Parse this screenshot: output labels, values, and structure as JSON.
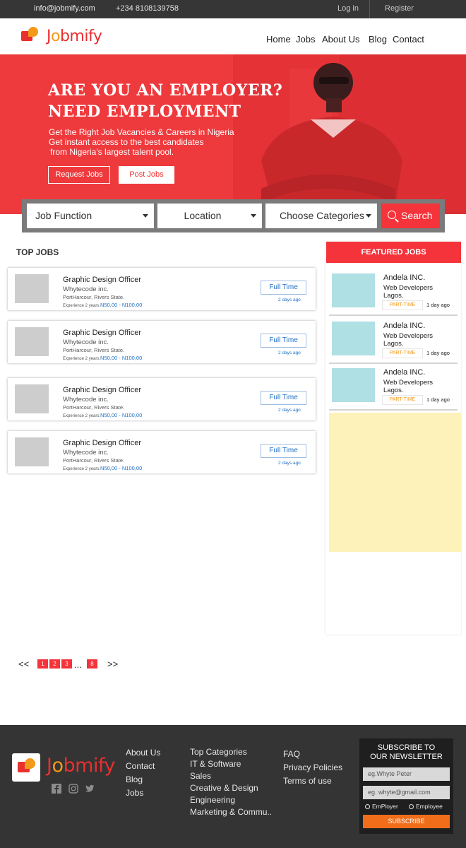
{
  "topbar": {
    "email": "info@jobmify.com",
    "phone": "+234 8108139758",
    "login": "Log in",
    "register": "Register"
  },
  "brand": {
    "name_a": "J",
    "name_o": "o",
    "name_b": "bmify"
  },
  "nav": {
    "home": "Home",
    "jobs": "Jobs",
    "about": "About Us",
    "blog": "Blog",
    "contact": "Contact"
  },
  "hero": {
    "line1": "ARE YOU AN EMPLOYER?",
    "line2": "NEED EMPLOYMENT",
    "sub1": "Get the Right Job Vacancies & Careers in Nigeria",
    "sub2": "Get instant access to the best candidates",
    "sub3": "from Nigeria's largest talent pool.",
    "request_btn": "Request Jobs",
    "post_btn": "Post Jobs"
  },
  "search": {
    "job_function": "Job Function",
    "location": "Location",
    "categories": "Choose Categories",
    "button": "Search"
  },
  "top_jobs": {
    "title": "TOP JOBS",
    "items": [
      {
        "title": "Graphic Design Officer",
        "company": "Whytecode inc.",
        "location": "PortHarcour, Rivers State.",
        "experience": "Experience 2 years.",
        "salary": "N50,00 - N100,00",
        "type": "Full Time",
        "ago": "2 days ago"
      },
      {
        "title": "Graphic Design Officer",
        "company": "Whytecode inc.",
        "location": "PortHarcour, Rivers State.",
        "experience": "Experience 2 years.",
        "salary": "N50,00 - N100,00",
        "type": "Full Time",
        "ago": "2 days ago"
      },
      {
        "title": "Graphic Design Officer",
        "company": "Whytecode inc.",
        "location": "PortHarcour, Rivers State.",
        "experience": "Experience 2 years.",
        "salary": "N50,00 - N100,00",
        "type": "Full Time",
        "ago": "2 days ago"
      },
      {
        "title": "Graphic Design Officer",
        "company": "Whytecode inc.",
        "location": "PortHarcour, Rivers State.",
        "experience": "Experience 2 years.",
        "salary": "N50,00 - N100,00",
        "type": "Full Time",
        "ago": "2 days ago"
      }
    ]
  },
  "featured": {
    "title": "FEATURED JOBS",
    "items": [
      {
        "company": "Andela INC.",
        "role": "Web Developers Lagos.",
        "badge": "PART-TIME",
        "ago": "1 day ago"
      },
      {
        "company": "Andela INC.",
        "role": "Web Developers Lagos.",
        "badge": "PART-TIME",
        "ago": "1 day ago"
      },
      {
        "company": "Andela INC.",
        "role": "Web Developers Lagos.",
        "badge": "PART-TIME",
        "ago": "1 day ago"
      }
    ]
  },
  "pagination": {
    "prev": "<<",
    "pages": [
      "1",
      "2",
      "3"
    ],
    "ellipsis": "...",
    "last": "8",
    "next": ">>"
  },
  "footer": {
    "col1": [
      "About Us",
      "Contact",
      "Blog",
      "Jobs"
    ],
    "col2": [
      "Top Categories",
      "IT & Software",
      "Sales",
      "Creative & Design",
      "Engineering",
      "Marketing & Commu.."
    ],
    "col3": [
      "FAQ",
      "Privacy Policies",
      "Terms of use"
    ],
    "subscribe_title_1": "SUBSCRIBE TO",
    "subscribe_title_2": "OUR NEWSLETTER",
    "name_placeholder": "eg.Whyte Peter",
    "email_placeholder": "eg. whyte@gmail.com",
    "radio_employer": "EmPloyer",
    "radio_employee": "Employee",
    "subscribe_btn": "SUBSCRIBE"
  },
  "colors": {
    "accent": "#f5333b",
    "hero": "#ee3a3d",
    "orange": "#f39a1a",
    "link": "#1f6fc4",
    "footer": "#343434"
  }
}
